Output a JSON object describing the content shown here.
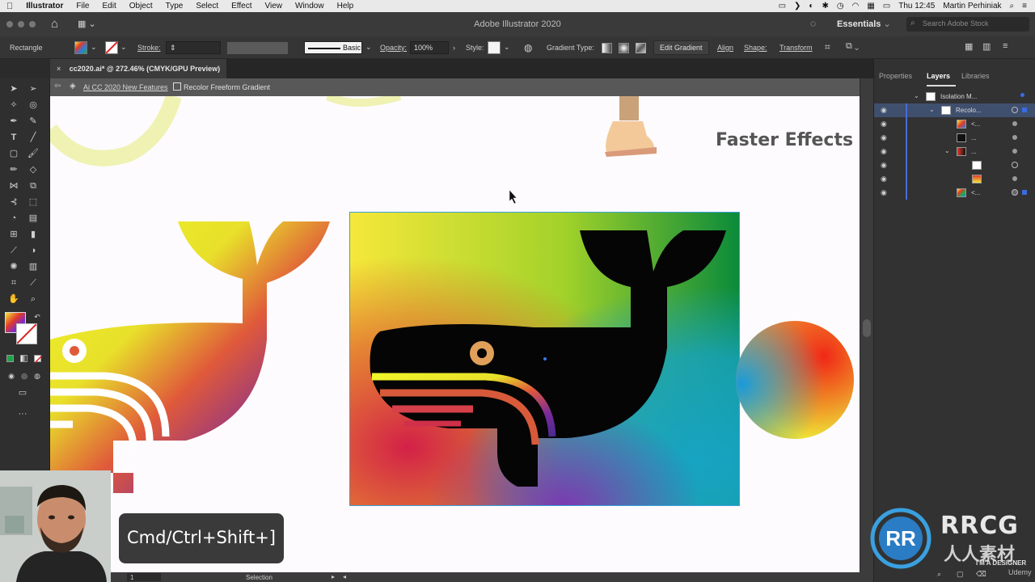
{
  "menubar": {
    "apple": "",
    "items": [
      "Illustrator",
      "File",
      "Edit",
      "Object",
      "Type",
      "Select",
      "Effect",
      "View",
      "Window",
      "Help"
    ],
    "clock": "Thu 12:45",
    "user": "Martin Perhiniak"
  },
  "titlebar": {
    "title": "Adobe Illustrator 2020",
    "workspace": "Essentials",
    "search_placeholder": "Search Adobe Stock"
  },
  "controlbar": {
    "tool_name": "Rectangle",
    "stroke_label": "Stroke:",
    "brush_label": "Basic",
    "opacity_label": "Opacity:",
    "opacity_value": "100%",
    "style_label": "Style:",
    "gradient_type_label": "Gradient Type:",
    "edit_gradient": "Edit Gradient",
    "align": "Align",
    "shape": "Shape:",
    "transform": "Transform"
  },
  "document": {
    "tab_title": "cc2020.ai* @ 272.46% (CMYK/GPU Preview)",
    "tab_close": "×"
  },
  "isolation": {
    "crumb_1": "Ai CC 2020 New Features",
    "crumb_2": "Recolor Freeform Gradient"
  },
  "canvas": {
    "heading": "Faster Effects"
  },
  "panel": {
    "tabs": [
      "Properties",
      "Layers",
      "Libraries"
    ],
    "active_tab": "Layers",
    "layers": [
      {
        "name": "Isolation M...",
        "indent": 1
      },
      {
        "name": "Recolo...",
        "indent": 2,
        "selected": true
      },
      {
        "name": "<...",
        "indent": 3
      },
      {
        "name": "...",
        "indent": 3
      },
      {
        "name": "...",
        "indent": 3
      },
      {
        "name": "",
        "indent": 4
      },
      {
        "name": "",
        "indent": 4
      },
      {
        "name": "<...",
        "indent": 3
      }
    ]
  },
  "statusbar": {
    "artboard": "1",
    "tool": "Selection"
  },
  "overlay": {
    "shortcut": "Cmd/Ctrl+Shift+]"
  },
  "watermark": {
    "brand": "RRCG",
    "cn": "人人素材",
    "tagline": "I'M A DESIGNER",
    "platform": "Udemy"
  },
  "colors": {
    "gradient_yellow": "#e8f52a",
    "gradient_green": "#0a8a3a",
    "gradient_red": "#d0204a",
    "gradient_teal": "#17a3c3",
    "gradient_purple": "#5a2a90",
    "eye_orange": "#e0a05a",
    "layer_blue": "#4a6cd6"
  }
}
